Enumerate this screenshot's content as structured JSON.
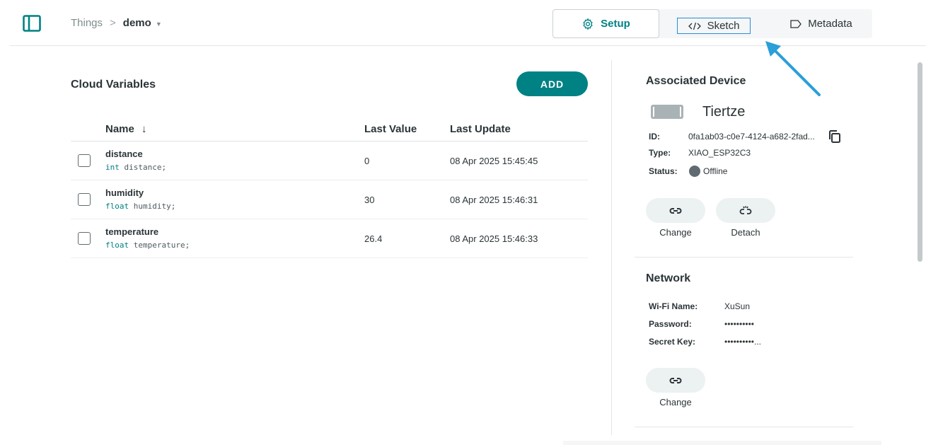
{
  "header": {
    "breadcrumb_root": "Things",
    "breadcrumb_sep": ">",
    "breadcrumb_current": "demo",
    "tabs": [
      {
        "label": "Setup",
        "icon": "gear-icon"
      },
      {
        "label": "Sketch",
        "icon": "code-icon"
      },
      {
        "label": "Metadata",
        "icon": "tag-icon"
      }
    ]
  },
  "cloud_variables": {
    "title": "Cloud Variables",
    "add_label": "ADD",
    "columns": {
      "name": "Name",
      "last_value": "Last Value",
      "last_update": "Last Update"
    },
    "rows": [
      {
        "name": "distance",
        "type": "int",
        "decl": " distance;",
        "value": "0",
        "updated": "08 Apr 2025 15:45:45"
      },
      {
        "name": "humidity",
        "type": "float",
        "decl": " humidity;",
        "value": "30",
        "updated": "08 Apr 2025 15:46:31"
      },
      {
        "name": "temperature",
        "type": "float",
        "decl": " temperature;",
        "value": "26.4",
        "updated": "08 Apr 2025 15:46:33"
      }
    ]
  },
  "device": {
    "title": "Associated Device",
    "name": "Tiertze",
    "id_label": "ID:",
    "id_value": "0fa1ab03-c0e7-4124-a682-2fad...",
    "type_label": "Type:",
    "type_value": "XIAO_ESP32C3",
    "status_label": "Status:",
    "status_value": "Offline",
    "change_label": "Change",
    "detach_label": "Detach"
  },
  "network": {
    "title": "Network",
    "wifi_label": "Wi-Fi Name:",
    "wifi_value": "XuSun",
    "password_label": "Password:",
    "password_value": "••••••••••",
    "secret_label": "Secret Key:",
    "secret_value": "••••••••••...",
    "change_label": "Change"
  },
  "colors": {
    "accent": "#008184",
    "annotation": "#2a9fd8",
    "offline": "#5f6b70"
  }
}
